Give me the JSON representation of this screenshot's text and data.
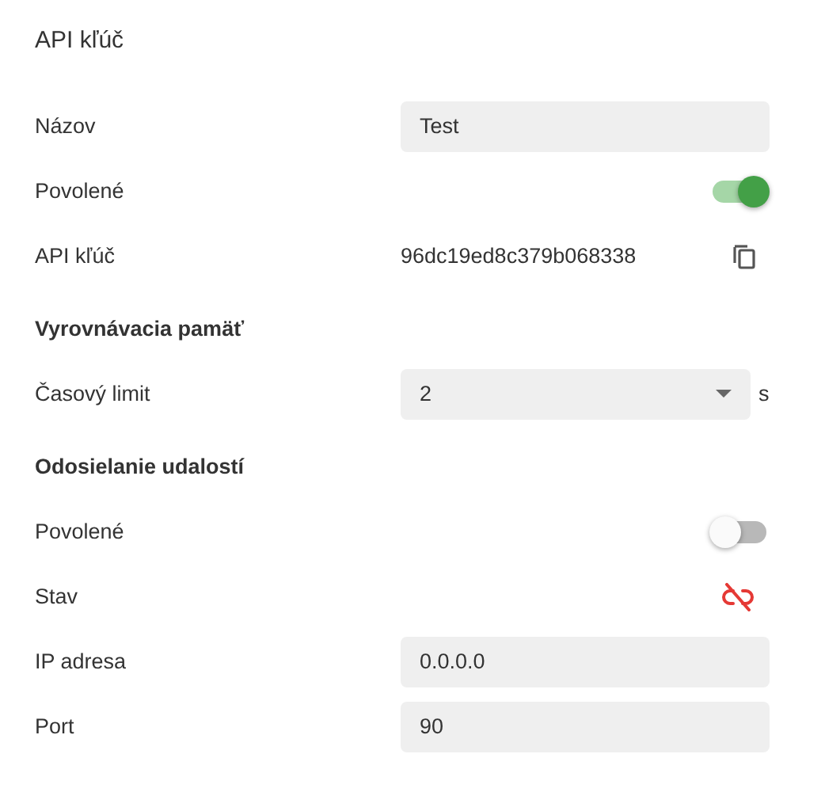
{
  "title": "API kľúč",
  "sections": [
    {
      "rows": [
        {
          "kind": "input",
          "label": "Názov",
          "value": "Test"
        },
        {
          "kind": "toggle",
          "label": "Povolené",
          "on": true
        },
        {
          "kind": "key",
          "label": "API kľúč",
          "value": "96dc19ed8c379b068338"
        }
      ]
    },
    {
      "heading": "Vyrovnávacia pamäť",
      "rows": [
        {
          "kind": "select",
          "label": "Časový limit",
          "value": "2",
          "unit": "s"
        }
      ]
    },
    {
      "heading": "Odosielanie udalostí",
      "rows": [
        {
          "kind": "toggle",
          "label": "Povolené",
          "on": false
        },
        {
          "kind": "status",
          "label": "Stav",
          "connected": false
        },
        {
          "kind": "input",
          "label": "IP adresa",
          "value": "0.0.0.0"
        },
        {
          "kind": "input",
          "label": "Port",
          "value": "90"
        }
      ]
    }
  ]
}
